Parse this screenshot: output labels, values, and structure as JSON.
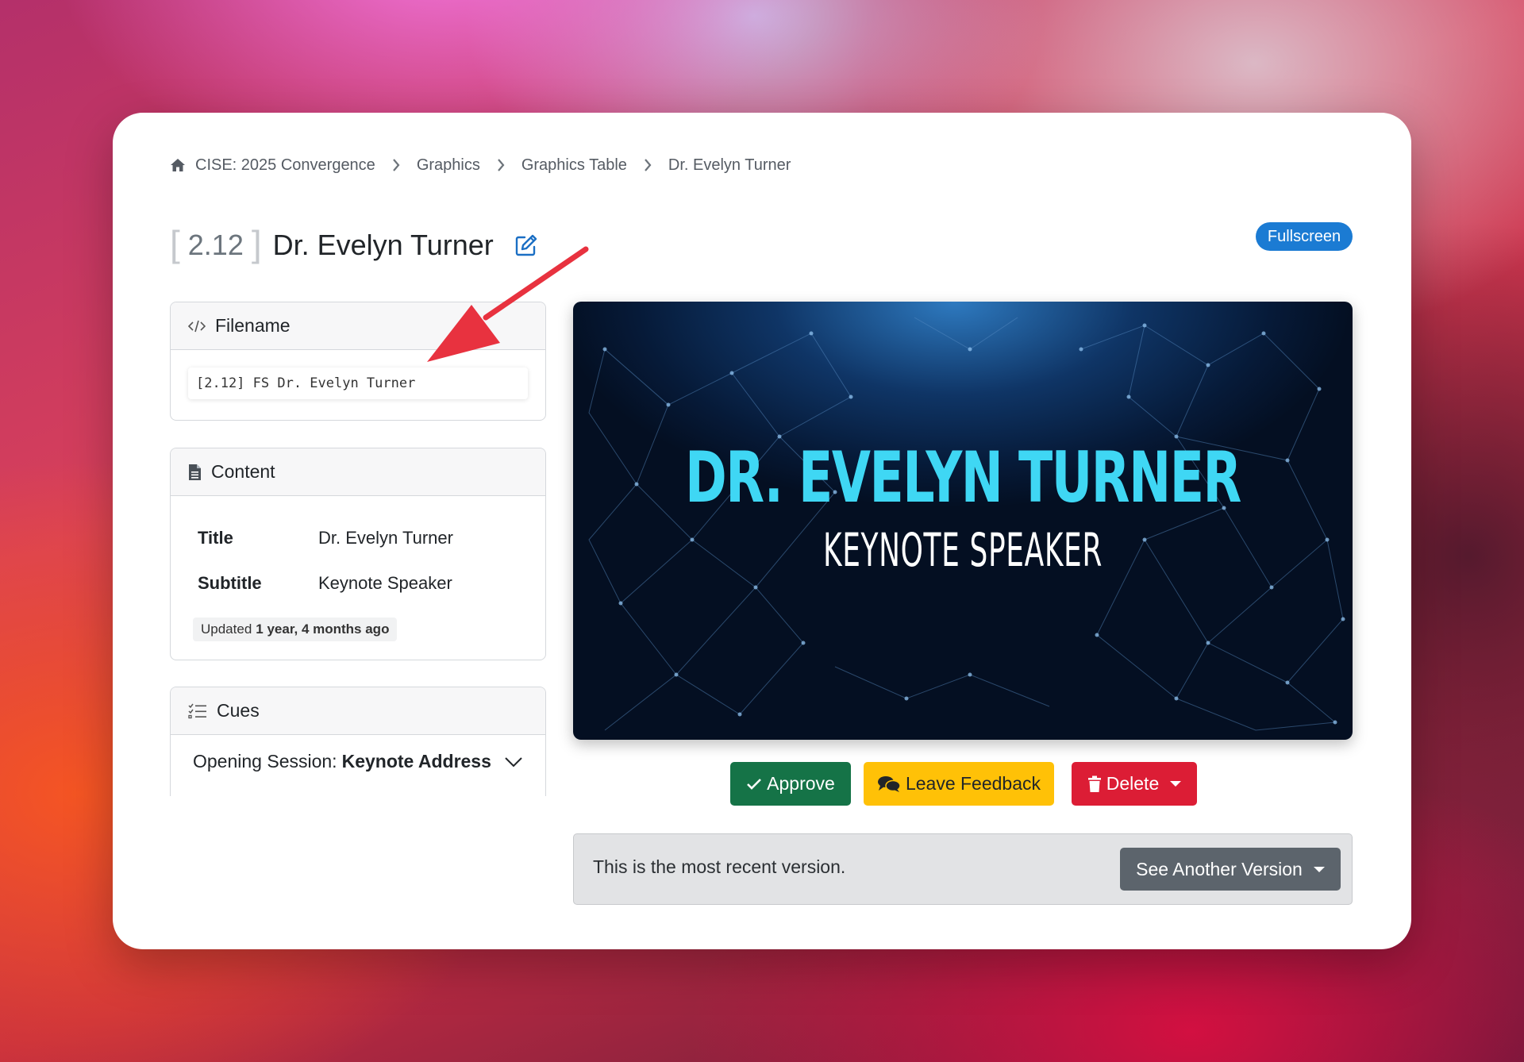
{
  "breadcrumb": {
    "items": [
      {
        "label": "CISE: 2025 Convergence"
      },
      {
        "label": "Graphics"
      },
      {
        "label": "Graphics Table"
      },
      {
        "label": "Dr. Evelyn Turner"
      }
    ]
  },
  "header": {
    "number": "2.12",
    "title": "Dr. Evelyn Turner",
    "fullscreen_label": "Fullscreen"
  },
  "filename_panel": {
    "heading": "Filename",
    "value": "[2.12] FS Dr. Evelyn Turner"
  },
  "content_panel": {
    "heading": "Content",
    "fields": [
      {
        "label": "Title",
        "value": "Dr. Evelyn Turner"
      },
      {
        "label": "Subtitle",
        "value": "Keynote Speaker"
      }
    ],
    "updated_prefix": "Updated",
    "updated_value": "1 year, 4 months ago"
  },
  "cues_panel": {
    "heading": "Cues",
    "cue_prefix": "Opening Session:",
    "cue_name": "Keynote Address"
  },
  "preview": {
    "title": "DR. EVELYN TURNER",
    "subtitle": "KEYNOTE SPEAKER"
  },
  "actions": {
    "approve_label": "Approve",
    "feedback_label": "Leave Feedback",
    "delete_label": "Delete"
  },
  "version": {
    "message": "This is the most recent version.",
    "see_another_label": "See Another Version"
  },
  "colors": {
    "approve": "#157347",
    "feedback": "#ffc107",
    "delete": "#dc1d35",
    "fullscreen": "#1b7bd3",
    "preview_title": "#3fd7f4",
    "annotation_arrow": "#e8323f"
  },
  "icons": [
    "home-icon",
    "chevron-right-icon",
    "edit-icon",
    "code-icon",
    "file-icon",
    "checklist-icon",
    "chevron-down-icon",
    "check-icon",
    "comments-icon",
    "trash-icon",
    "caret-down-icon"
  ]
}
